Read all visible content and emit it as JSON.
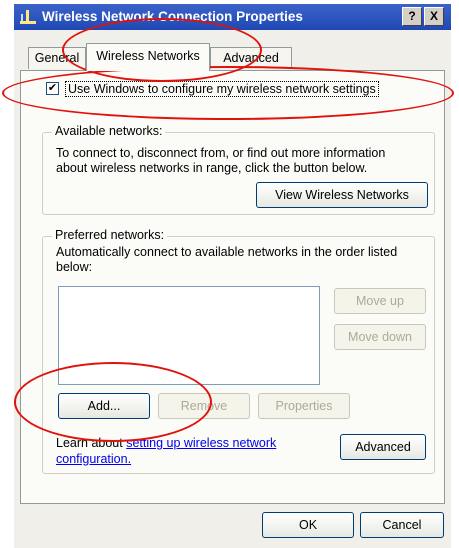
{
  "window": {
    "title": "Wireless Network Connection Properties",
    "help_btn": "?",
    "close_btn": "X"
  },
  "tabs": [
    {
      "label": "General"
    },
    {
      "label": "Wireless Networks",
      "active": true
    },
    {
      "label": "Advanced"
    }
  ],
  "use_windows_checkbox": {
    "checked": true,
    "check_glyph": "✔",
    "label": "Use Windows to configure my wireless network settings"
  },
  "available_networks": {
    "title": "Available networks:",
    "description_line1": "To connect to, disconnect from, or find out more information",
    "description_line2": "about wireless networks in range, click the button below.",
    "view_button": "View Wireless Networks"
  },
  "preferred_networks": {
    "title": "Preferred networks:",
    "description_line1": "Automatically connect to available networks in the order listed",
    "description_line2": "below:",
    "move_up": "Move up",
    "move_down": "Move down",
    "add": "Add...",
    "remove": "Remove",
    "properties": "Properties",
    "learn_prefix": "Learn about ",
    "learn_link_line1": "setting up wireless network",
    "learn_link_line2": "configuration.",
    "advanced": "Advanced"
  },
  "footer": {
    "ok": "OK",
    "cancel": "Cancel"
  },
  "colors": {
    "title_bar": "#2a54c0",
    "annotation": "#e0120c",
    "link": "#0000ee"
  }
}
